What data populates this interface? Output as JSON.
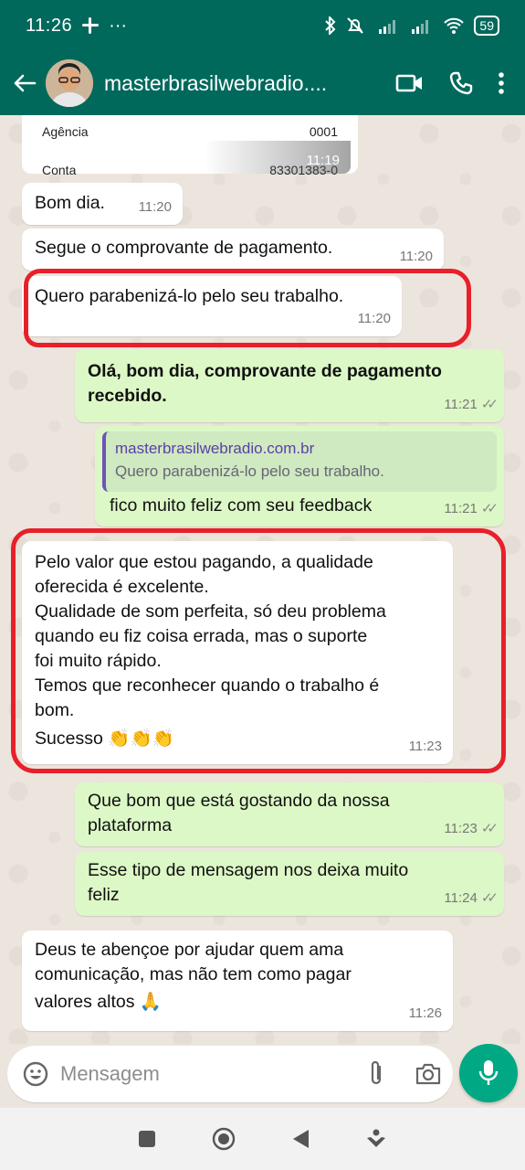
{
  "status": {
    "time": "11:26",
    "battery": "59"
  },
  "header": {
    "contact_name": "masterbrasilwebradio...."
  },
  "receipt": {
    "row1_label": "Agência",
    "row1_value": "0001",
    "row2_label": "Conta",
    "row2_value": "83301383-0",
    "time": "11:19"
  },
  "messages": [
    {
      "text": "Bom dia.",
      "time": "11:20"
    },
    {
      "text": "Segue o comprovante de pagamento.",
      "time": "11:20"
    },
    {
      "text": "Quero parabenizá-lo pelo seu trabalho.",
      "time": "11:20"
    },
    {
      "line1": "Olá, bom dia, comprovante de pagamento",
      "line2": "recebido.",
      "time": "11:21"
    },
    {
      "quote_author": "masterbrasilwebradio.com.br",
      "quote_text": "Quero parabenizá-lo pelo seu trabalho.",
      "text": "fico muito feliz com seu feedback",
      "time": "11:21"
    },
    {
      "lines": [
        "Pelo valor que estou pagando, a qualidade",
        "oferecida é excelente.",
        "Qualidade de som perfeita, só deu problema",
        "quando eu fiz coisa errada, mas o suporte",
        "foi muito rápido.",
        "Temos que reconhecer quando o trabalho é",
        "bom."
      ],
      "last": "Sucesso 👏👏👏",
      "time": "11:23"
    },
    {
      "line1": "Que bom que está gostando da nossa",
      "line2": "plataforma",
      "time": "11:23"
    },
    {
      "line1": "Esse tipo de mensagem nos deixa muito",
      "line2": "feliz",
      "time": "11:24"
    },
    {
      "line1": "Deus te abençoe por ajudar quem ama",
      "line2": "comunicação, mas não tem como pagar",
      "line3": "valores altos 🙏",
      "time": "11:26"
    }
  ],
  "input": {
    "placeholder": "Mensagem"
  },
  "colors": {
    "header": "#00695c",
    "outgoing": "#dcf8c6",
    "incoming": "#ffffff",
    "annotation": "#e8202a",
    "accent": "#00a884"
  }
}
